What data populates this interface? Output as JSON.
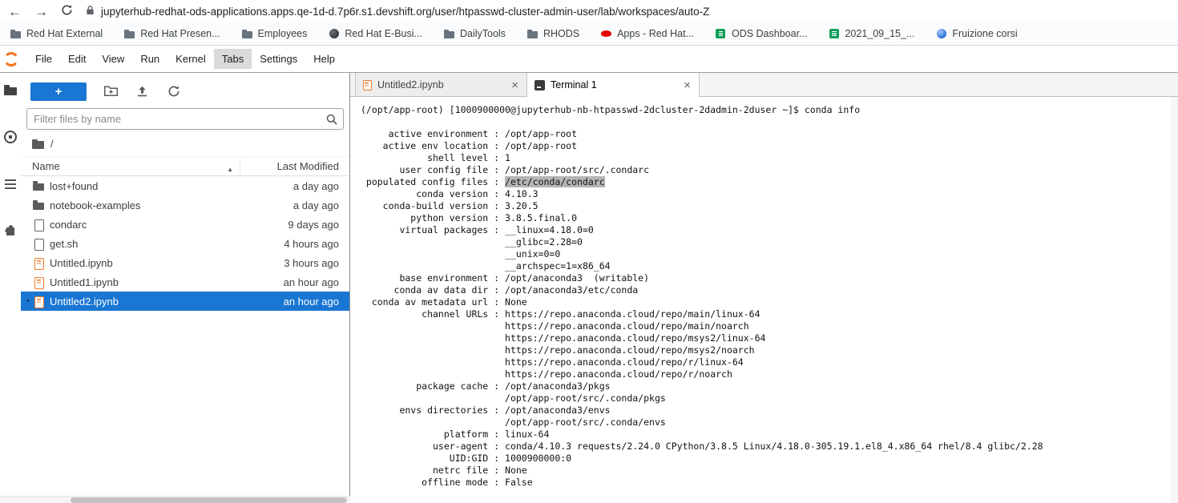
{
  "browser": {
    "nav": {
      "back_glyph": "←",
      "forward_glyph": "→"
    },
    "url": "jupyterhub-redhat-ods-applications.apps.qe-1d-d.7p6r.s1.devshift.org/user/htpasswd-cluster-admin-user/lab/workspaces/auto-Z",
    "bookmarks": [
      {
        "label": "Red Hat External",
        "icon": "folder"
      },
      {
        "label": "Red Hat Presen...",
        "icon": "folder"
      },
      {
        "label": "Employees",
        "icon": "folder"
      },
      {
        "label": "Red Hat E-Busi...",
        "icon": "globe-dark"
      },
      {
        "label": "DailyTools",
        "icon": "folder"
      },
      {
        "label": "RHODS",
        "icon": "folder"
      },
      {
        "label": "Apps - Red Hat...",
        "icon": "redhat"
      },
      {
        "label": "ODS Dashboar...",
        "icon": "sheet-green"
      },
      {
        "label": "2021_09_15_...",
        "icon": "sheet-green"
      },
      {
        "label": "Fruizione corsi",
        "icon": "globe-blue"
      }
    ]
  },
  "menu": {
    "items": [
      {
        "label": "File",
        "state": ""
      },
      {
        "label": "Edit",
        "state": ""
      },
      {
        "label": "View",
        "state": ""
      },
      {
        "label": "Run",
        "state": ""
      },
      {
        "label": "Kernel",
        "state": ""
      },
      {
        "label": "Tabs",
        "state": "active"
      },
      {
        "label": "Settings",
        "state": ""
      },
      {
        "label": "Help",
        "state": ""
      }
    ]
  },
  "sidebar": {
    "tabs": [
      {
        "icon": "folder",
        "state": "active"
      },
      {
        "icon": "running",
        "state": ""
      },
      {
        "icon": "toc",
        "state": ""
      },
      {
        "icon": "extensions",
        "state": ""
      }
    ]
  },
  "filebrowser": {
    "new_launcher_label": "+",
    "filter_placeholder": "Filter files by name",
    "breadcrumb_root": "/",
    "columns": {
      "name": "Name",
      "modified": "Last Modified"
    },
    "sort_indicator": "▲",
    "rows": [
      {
        "name": "lost+found",
        "modified": "a day ago",
        "icon": "folder",
        "state": ""
      },
      {
        "name": "notebook-examples",
        "modified": "a day ago",
        "icon": "folder",
        "state": ""
      },
      {
        "name": "condarc",
        "modified": "9 days ago",
        "icon": "file",
        "state": ""
      },
      {
        "name": "get.sh",
        "modified": "4 hours ago",
        "icon": "file",
        "state": ""
      },
      {
        "name": "Untitled.ipynb",
        "modified": "3 hours ago",
        "icon": "notebook",
        "state": ""
      },
      {
        "name": "Untitled1.ipynb",
        "modified": "an hour ago",
        "icon": "notebook",
        "state": ""
      },
      {
        "name": "Untitled2.ipynb",
        "modified": "an hour ago",
        "icon": "notebook",
        "state": "selected",
        "dot": "●"
      }
    ]
  },
  "tabs": [
    {
      "label": "Untitled2.ipynb",
      "icon": "notebook",
      "state": "",
      "close": "×"
    },
    {
      "label": "Terminal 1",
      "icon": "terminal",
      "state": "active",
      "close": "×"
    }
  ],
  "terminal": {
    "prompt": "(/opt/app-root) [1000900000@jupyterhub-nb-htpasswd-2dcluster-2dadmin-2duser ~]$ conda info",
    "lines": [
      {
        "label": "active environment",
        "sep": " : ",
        "value": "/opt/app-root",
        "vclass": ""
      },
      {
        "label": "active env location",
        "sep": " : ",
        "value": "/opt/app-root",
        "vclass": ""
      },
      {
        "label": "shell level",
        "sep": " : ",
        "value": "1",
        "vclass": ""
      },
      {
        "label": "user config file",
        "sep": " : ",
        "value": "/opt/app-root/src/.condarc",
        "vclass": ""
      },
      {
        "label": "populated config files",
        "sep": " : ",
        "value": "/etc/conda/condarc",
        "vclass": "hl"
      },
      {
        "label": "conda version",
        "sep": " : ",
        "value": "4.10.3",
        "vclass": ""
      },
      {
        "label": "conda-build version",
        "sep": " : ",
        "value": "3.20.5",
        "vclass": ""
      },
      {
        "label": "python version",
        "sep": " : ",
        "value": "3.8.5.final.0",
        "vclass": ""
      },
      {
        "label": "virtual packages",
        "sep": " : ",
        "value": "__linux=4.18.0=0",
        "vclass": ""
      },
      {
        "label": "",
        "sep": "   ",
        "value": "__glibc=2.28=0",
        "vclass": ""
      },
      {
        "label": "",
        "sep": "   ",
        "value": "__unix=0=0",
        "vclass": ""
      },
      {
        "label": "",
        "sep": "   ",
        "value": "__archspec=1=x86_64",
        "vclass": ""
      },
      {
        "label": "base environment",
        "sep": " : ",
        "value": "/opt/anaconda3  (writable)",
        "vclass": ""
      },
      {
        "label": "conda av data dir",
        "sep": " : ",
        "value": "/opt/anaconda3/etc/conda",
        "vclass": ""
      },
      {
        "label": "conda av metadata url",
        "sep": " : ",
        "value": "None",
        "vclass": ""
      },
      {
        "label": "channel URLs",
        "sep": " : ",
        "value": "https://repo.anaconda.cloud/repo/main/linux-64",
        "vclass": ""
      },
      {
        "label": "",
        "sep": "   ",
        "value": "https://repo.anaconda.cloud/repo/main/noarch",
        "vclass": ""
      },
      {
        "label": "",
        "sep": "   ",
        "value": "https://repo.anaconda.cloud/repo/msys2/linux-64",
        "vclass": ""
      },
      {
        "label": "",
        "sep": "   ",
        "value": "https://repo.anaconda.cloud/repo/msys2/noarch",
        "vclass": ""
      },
      {
        "label": "",
        "sep": "   ",
        "value": "https://repo.anaconda.cloud/repo/r/linux-64",
        "vclass": ""
      },
      {
        "label": "",
        "sep": "   ",
        "value": "https://repo.anaconda.cloud/repo/r/noarch",
        "vclass": ""
      },
      {
        "label": "package cache",
        "sep": " : ",
        "value": "/opt/anaconda3/pkgs",
        "vclass": ""
      },
      {
        "label": "",
        "sep": "   ",
        "value": "/opt/app-root/src/.conda/pkgs",
        "vclass": ""
      },
      {
        "label": "envs directories",
        "sep": " : ",
        "value": "/opt/anaconda3/envs",
        "vclass": ""
      },
      {
        "label": "",
        "sep": "   ",
        "value": "/opt/app-root/src/.conda/envs",
        "vclass": ""
      },
      {
        "label": "platform",
        "sep": " : ",
        "value": "linux-64",
        "vclass": ""
      },
      {
        "label": "user-agent",
        "sep": " : ",
        "value": "conda/4.10.3 requests/2.24.0 CPython/3.8.5 Linux/4.18.0-305.19.1.el8_4.x86_64 rhel/8.4 glibc/2.28",
        "vclass": ""
      },
      {
        "label": "UID:GID",
        "sep": " : ",
        "value": "1000900000:0",
        "vclass": ""
      },
      {
        "label": "netrc file",
        "sep": " : ",
        "value": "None",
        "vclass": ""
      },
      {
        "label": "offline mode",
        "sep": " : ",
        "value": "False",
        "vclass": ""
      }
    ]
  },
  "colors": {
    "jupyter_orange": "#f37726",
    "accent_blue": "#1976d2",
    "terminal_selection_gray": "#b5b5b5",
    "bookmark_green": "#0f9d58",
    "redhat_red": "#e60000"
  }
}
